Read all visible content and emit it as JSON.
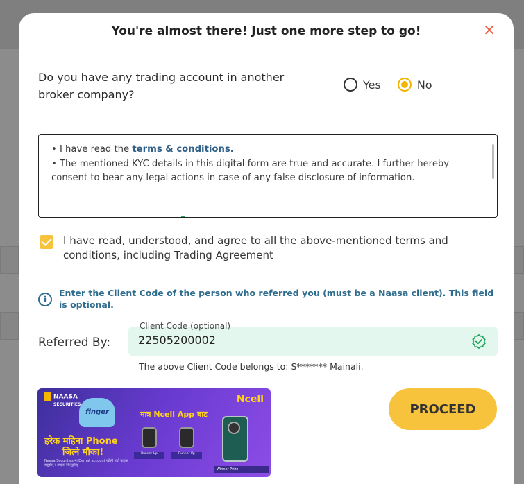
{
  "modal": {
    "title": "You're almost there! Just one more step to go!",
    "close_icon": "close-icon"
  },
  "trading_question": {
    "text": "Do you have any trading account in another broker company?",
    "options": [
      {
        "label": "Yes",
        "selected": false
      },
      {
        "label": "No",
        "selected": true
      }
    ]
  },
  "terms": {
    "bullet_1_prefix": "• I have read the ",
    "bullet_1_link": "terms & conditions.",
    "bullet_2": "• The mentioned KYC details in this digital form are true and accurate. I further hereby consent to bear any legal actions in case of any false disclosure of information."
  },
  "agreement": {
    "checked": true,
    "text": "I have read, understood, and agree to all the above-mentioned terms and conditions, including Trading Agreement"
  },
  "referral": {
    "info": "Enter the Client Code of the person who referred you (must be a Naasa client). This field is optional.",
    "label": "Referred By:",
    "field_label": "Client Code (optional)",
    "value": "22505200002",
    "owner_text": "The above Client Code belongs to: S******* Mainali."
  },
  "banner": {
    "logo": "NAASA",
    "logo_sub": "SECURITIES",
    "mascot": "finger",
    "brand": "Ncell",
    "app_text": "मात्र Ncell App बाट",
    "headline_1": "हरेक महिना Phone",
    "headline_2": "जित्ने मौका!",
    "small_text": "Naasa Securities मा Demat account खोली नयाँ ग्राहक बन्नुहोस् र उपहार जित्नुहोस्",
    "watch_1_caption": "Runner Up",
    "watch_2_caption": "Runner Up",
    "winner_caption": "Winner Prize"
  },
  "actions": {
    "proceed_label": "PROCEED"
  },
  "colors": {
    "accent": "#f7c23c",
    "close": "#f05a3c",
    "info": "#2f6d8f",
    "field_bg": "#e3f7ee",
    "verified": "#1fa35b"
  }
}
